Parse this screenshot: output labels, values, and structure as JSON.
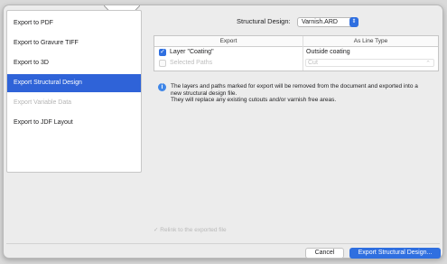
{
  "sidebar": {
    "items": [
      {
        "label": "Export to PDF",
        "state": "normal"
      },
      {
        "label": "Export to Gravure TIFF",
        "state": "normal"
      },
      {
        "label": "Export to 3D",
        "state": "normal"
      },
      {
        "label": "Export Structural Design",
        "state": "selected"
      },
      {
        "label": "Export Variable Data",
        "state": "disabled"
      },
      {
        "label": "Export to JDF Layout",
        "state": "normal"
      }
    ]
  },
  "structural_design": {
    "label": "Structural Design:",
    "value": "Varnish.ARD"
  },
  "table": {
    "headers": {
      "export": "Export",
      "as_line_type": "As Line Type"
    },
    "rows": [
      {
        "checked": true,
        "enabled": true,
        "name": "Layer \"Coating\"",
        "line_type": "Outside coating"
      },
      {
        "checked": false,
        "enabled": false,
        "name": "Selected Paths",
        "line_type": "Cut"
      }
    ]
  },
  "info": {
    "line1": "The layers and paths marked for export will be removed from the document and exported into a",
    "line2": "new structural design file.",
    "line3": "They will replace any existing cutouts and/or varnish free areas."
  },
  "relink": {
    "label": "Relink to the exported file",
    "checked": true,
    "enabled": false
  },
  "buttons": {
    "cancel": "Cancel",
    "export": "Export Structural Design..."
  },
  "icons": {
    "info": "info-icon",
    "checkmark": "checkmark-icon",
    "popup": "popup-chevron-icon"
  },
  "colors": {
    "accent": "#2f6fe0",
    "selection": "#2f63d8"
  }
}
